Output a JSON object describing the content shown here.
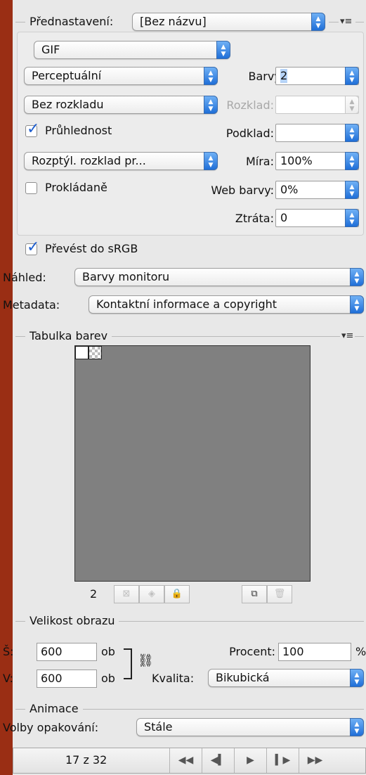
{
  "preset": {
    "label": "Přednastavení:",
    "value": "[Bez názvu]",
    "menu_icon": "flyout-menu-icon"
  },
  "format": {
    "value": "GIF"
  },
  "reduction": {
    "value": "Perceptuální"
  },
  "colors": {
    "label": "Barvy:",
    "value": "2"
  },
  "dither_algo": {
    "value": "Bez rozkladu"
  },
  "dither_amount": {
    "label": "Rozklad:",
    "value": ""
  },
  "transparency": {
    "label": "Průhlednost",
    "checked": true
  },
  "matte": {
    "label": "Podklad:",
    "value": ""
  },
  "transparency_dither": {
    "value": "Rozptýl. rozklad pr..."
  },
  "amount": {
    "label": "Míra:",
    "value": "100%"
  },
  "interlaced": {
    "label": "Prokládaně",
    "checked": false
  },
  "web_snap": {
    "label": "Web barvy:",
    "value": "0%"
  },
  "lossy": {
    "label": "Ztráta:",
    "value": "0"
  },
  "convert_srgb": {
    "label": "Převést do sRGB",
    "checked": true
  },
  "preview": {
    "label": "Náhled:",
    "value": "Barvy monitoru"
  },
  "metadata": {
    "label": "Metadata:",
    "value": "Kontaktní informace a copyright"
  },
  "color_table": {
    "title": "Tabulka barev",
    "count": "2",
    "swatches": [
      "#ffffff",
      "transparent"
    ],
    "bg_color": "#808080"
  },
  "image_size": {
    "title": "Velikost obrazu",
    "width_label": "Š:",
    "width_value": "600",
    "height_label": "V:",
    "height_value": "600",
    "unit": "ob",
    "percent_label": "Procent:",
    "percent_value": "100",
    "percent_unit": "%",
    "quality_label": "Kvalita:",
    "quality_value": "Bikubická"
  },
  "animation": {
    "title": "Animace",
    "loop_label": "Volby opakování:",
    "loop_value": "Stále",
    "frame_counter": "17 z 32"
  }
}
